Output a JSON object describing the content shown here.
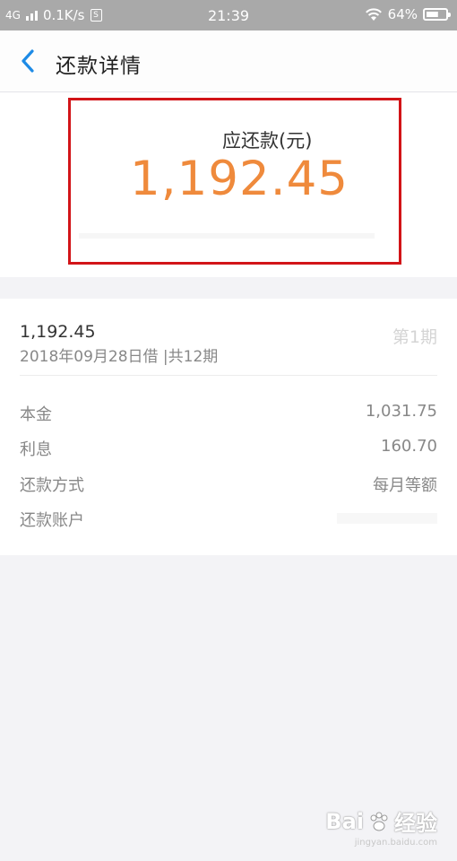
{
  "status_bar": {
    "network": "4G",
    "speed": "0.1K/s",
    "speed_icon": "S",
    "time": "21:39",
    "battery_percent": "64%",
    "battery_level": 0.64,
    "icons": [
      "signal-icon",
      "speed-icon",
      "wifi-icon",
      "battery-icon"
    ]
  },
  "header": {
    "title": "还款详情",
    "back_icon": "chevron-left-icon",
    "accent_color": "#1e8be6"
  },
  "summary": {
    "due_label": "应还款(元)",
    "due_amount": "1,192.45",
    "amount_color": "#ef8a3c",
    "highlight_color": "#d21418"
  },
  "detail": {
    "loan_amount": "1,192.45",
    "loan_info": "2018年09月28日借 |共12期",
    "period_badge": "第1期",
    "rows": [
      {
        "label": "本金",
        "value": "1,031.75"
      },
      {
        "label": "利息",
        "value": "160.70"
      },
      {
        "label": "还款方式",
        "value": "每月等额"
      },
      {
        "label": "还款账户",
        "value": ""
      }
    ]
  },
  "watermark": {
    "text": "Bai",
    "text2": "经验",
    "sub": "jingyan.baidu.com"
  }
}
